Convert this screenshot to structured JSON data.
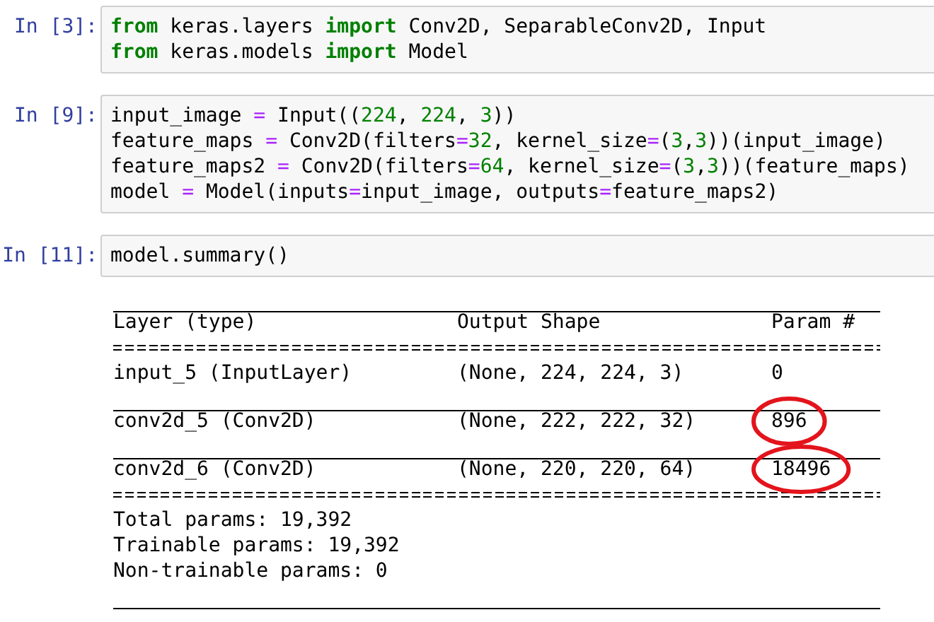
{
  "cells": [
    {
      "prompt": "In [3]:",
      "lines": [
        [
          {
            "kind": "keyword",
            "text": "from"
          },
          {
            "kind": "plain",
            "text": " keras.layers "
          },
          {
            "kind": "keyword",
            "text": "import"
          },
          {
            "kind": "plain",
            "text": " Conv2D, SeparableConv2D, Input"
          }
        ],
        [
          {
            "kind": "keyword",
            "text": "from"
          },
          {
            "kind": "plain",
            "text": " keras.models "
          },
          {
            "kind": "keyword",
            "text": "import"
          },
          {
            "kind": "plain",
            "text": " Model"
          }
        ]
      ]
    },
    {
      "prompt": "In [9]:",
      "lines": [
        [
          {
            "kind": "plain",
            "text": "input_image "
          },
          {
            "kind": "operator",
            "text": "="
          },
          {
            "kind": "plain",
            "text": " Input(("
          },
          {
            "kind": "number",
            "text": "224"
          },
          {
            "kind": "plain",
            "text": ", "
          },
          {
            "kind": "number",
            "text": "224"
          },
          {
            "kind": "plain",
            "text": ", "
          },
          {
            "kind": "number",
            "text": "3"
          },
          {
            "kind": "plain",
            "text": "))"
          }
        ],
        [
          {
            "kind": "plain",
            "text": "feature_maps "
          },
          {
            "kind": "operator",
            "text": "="
          },
          {
            "kind": "plain",
            "text": " Conv2D(filters"
          },
          {
            "kind": "operator",
            "text": "="
          },
          {
            "kind": "number",
            "text": "32"
          },
          {
            "kind": "plain",
            "text": ", kernel_size"
          },
          {
            "kind": "operator",
            "text": "="
          },
          {
            "kind": "plain",
            "text": "("
          },
          {
            "kind": "number",
            "text": "3"
          },
          {
            "kind": "plain",
            "text": ","
          },
          {
            "kind": "number",
            "text": "3"
          },
          {
            "kind": "plain",
            "text": "))(input_image)"
          }
        ],
        [
          {
            "kind": "plain",
            "text": "feature_maps2 "
          },
          {
            "kind": "operator",
            "text": "="
          },
          {
            "kind": "plain",
            "text": " Conv2D(filters"
          },
          {
            "kind": "operator",
            "text": "="
          },
          {
            "kind": "number",
            "text": "64"
          },
          {
            "kind": "plain",
            "text": ", kernel_size"
          },
          {
            "kind": "operator",
            "text": "="
          },
          {
            "kind": "plain",
            "text": "("
          },
          {
            "kind": "number",
            "text": "3"
          },
          {
            "kind": "plain",
            "text": ","
          },
          {
            "kind": "number",
            "text": "3"
          },
          {
            "kind": "plain",
            "text": "))(feature_maps)"
          }
        ],
        [
          {
            "kind": "plain",
            "text": "model "
          },
          {
            "kind": "operator",
            "text": "="
          },
          {
            "kind": "plain",
            "text": " Model(inputs"
          },
          {
            "kind": "operator",
            "text": "="
          },
          {
            "kind": "plain",
            "text": "input_image, outputs"
          },
          {
            "kind": "operator",
            "text": "="
          },
          {
            "kind": "plain",
            "text": "feature_maps2)"
          }
        ]
      ]
    },
    {
      "prompt": "In [11]:",
      "lines": [
        [
          {
            "kind": "plain",
            "text": "model.summary()"
          }
        ]
      ]
    }
  ],
  "output": [
    {
      "kind": "rule"
    },
    {
      "kind": "row",
      "cells": [
        {
          "text": "Layer (type)",
          "circled": false
        },
        {
          "text": "Output Shape",
          "circled": false
        },
        {
          "text": "Param #",
          "circled": false
        }
      ]
    },
    {
      "kind": "double_rule"
    },
    {
      "kind": "row",
      "cells": [
        {
          "text": "input_5 (InputLayer)",
          "circled": false
        },
        {
          "text": "(None, 224, 224, 3)",
          "circled": false
        },
        {
          "text": "0",
          "circled": false
        }
      ]
    },
    {
      "kind": "rule"
    },
    {
      "kind": "row",
      "cells": [
        {
          "text": "conv2d_5 (Conv2D)",
          "circled": false
        },
        {
          "text": "(None, 222, 222, 32)",
          "circled": false
        },
        {
          "text": "896",
          "circled": true
        }
      ]
    },
    {
      "kind": "rule"
    },
    {
      "kind": "row",
      "cells": [
        {
          "text": "conv2d_6 (Conv2D)",
          "circled": false
        },
        {
          "text": "(None, 220, 220, 64)",
          "circled": false
        },
        {
          "text": "18496",
          "circled": true
        }
      ]
    },
    {
      "kind": "double_rule"
    },
    {
      "kind": "text",
      "text": "Total params: 19,392"
    },
    {
      "kind": "text",
      "text": "Trainable params: 19,392"
    },
    {
      "kind": "text",
      "text": "Non-trainable params: 0"
    },
    {
      "kind": "rule"
    }
  ]
}
